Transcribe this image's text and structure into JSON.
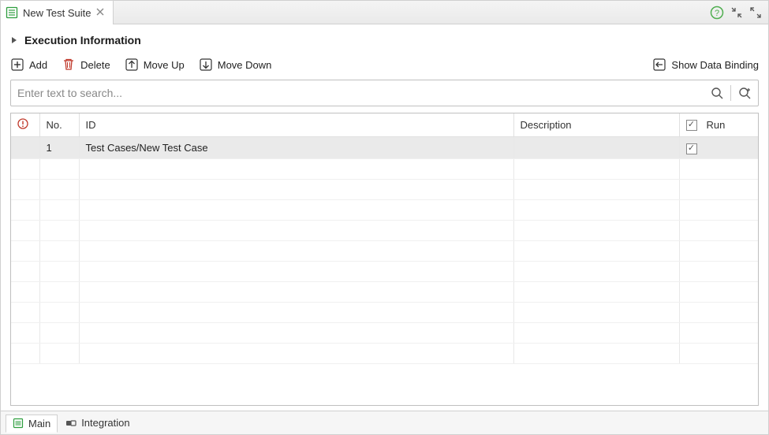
{
  "tab": {
    "title": "New Test Suite"
  },
  "section": {
    "title": "Execution Information"
  },
  "toolbar": {
    "add": "Add",
    "delete": "Delete",
    "moveUp": "Move Up",
    "moveDown": "Move Down",
    "showDataBinding": "Show Data Binding"
  },
  "search": {
    "placeholder": "Enter text to search..."
  },
  "table": {
    "columns": {
      "no": "No.",
      "id": "ID",
      "description": "Description",
      "run": "Run"
    },
    "rows": [
      {
        "no": "1",
        "id": "Test Cases/New Test Case",
        "description": "",
        "run": true
      }
    ],
    "emptyRows": 10
  },
  "bottomTabs": {
    "main": "Main",
    "integration": "Integration"
  }
}
